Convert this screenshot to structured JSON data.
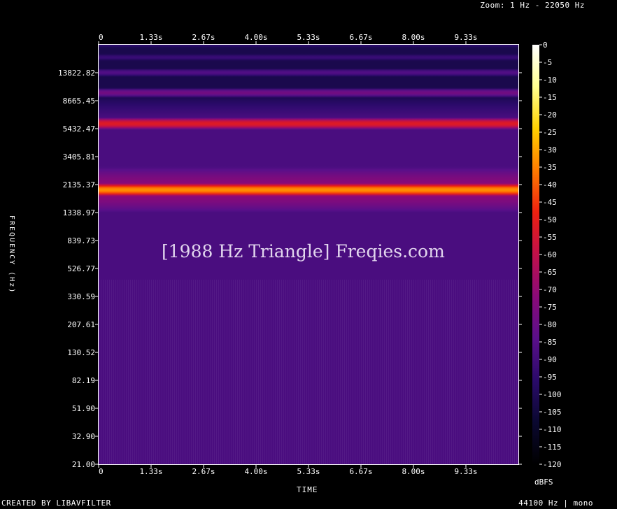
{
  "header": {
    "zoom": "Zoom: 1 Hz - 22050 Hz"
  },
  "footer": {
    "created_by": "CREATED BY LIBAVFILTER",
    "rate": "44100 Hz | mono"
  },
  "watermark": "[1988 Hz Triangle] Freqies.com",
  "chart_data": {
    "type": "heatmap",
    "xlabel": "TIME",
    "ylabel": "FREQUENCY (Hz)",
    "colorbar_label": "dBFS",
    "x_ticks": [
      "0",
      "1.33s",
      "2.67s",
      "4.00s",
      "5.33s",
      "6.67s",
      "8.00s",
      "9.33s"
    ],
    "xlim": [
      0,
      10.5
    ],
    "y_ticks": [
      "13822.82",
      "8665.45",
      "5432.47",
      "3405.81",
      "2135.37",
      "1338.97",
      "839.73",
      "526.77",
      "330.59",
      "207.61",
      "130.52",
      "82.19",
      "51.90",
      "32.90",
      "21.00"
    ],
    "ylim": [
      21,
      22050
    ],
    "y_scale": "log",
    "colorbar_ticks": [
      "0",
      "-5",
      "-10",
      "-15",
      "-20",
      "-25",
      "-30",
      "-35",
      "-40",
      "-45",
      "-50",
      "-55",
      "-60",
      "-65",
      "-70",
      "-75",
      "-80",
      "-85",
      "-90",
      "-95",
      "-100",
      "-105",
      "-110",
      "-115",
      "-120"
    ],
    "clim": [
      -120,
      0
    ],
    "harmonics_hz": [
      1988,
      5964,
      9940,
      13916,
      17892,
      21868
    ],
    "harmonics_db": [
      -33,
      -52,
      -64,
      -72,
      -78,
      -82
    ],
    "background_db": -88,
    "colormap": [
      "#000000",
      "#0a0830",
      "#2a0a6a",
      "#5a0f8a",
      "#8a0a78",
      "#c0104a",
      "#ee2010",
      "#ff7a00",
      "#ffd000",
      "#ffff90",
      "#ffffff"
    ]
  }
}
